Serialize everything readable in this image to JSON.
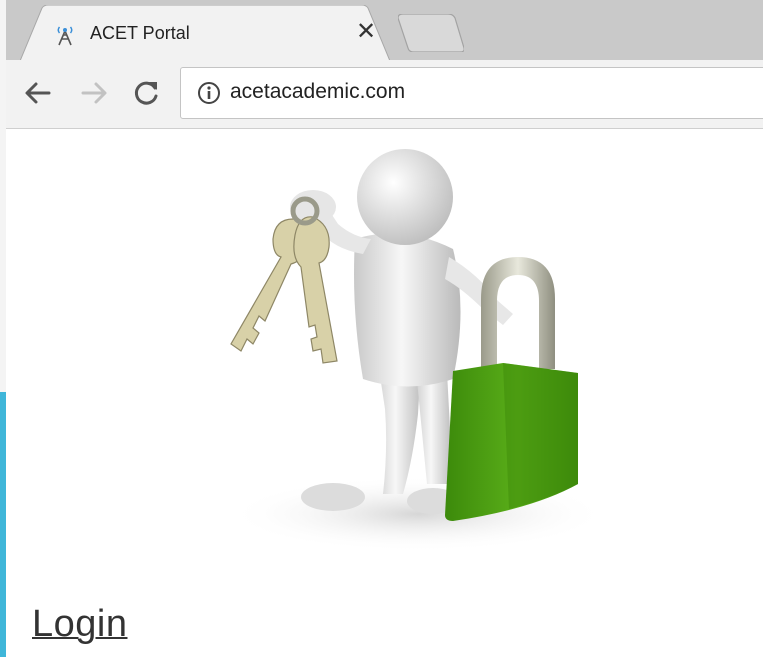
{
  "browser": {
    "tab": {
      "title": "ACET Portal",
      "close_glyph": "✕",
      "favicon": "radio-tower-icon"
    },
    "new_tab": {
      "icon": "new-tab-icon"
    },
    "toolbar": {
      "back_icon": "arrow-left-icon",
      "forward_icon": "arrow-right-icon",
      "reload_icon": "reload-icon",
      "site_info_icon": "info-icon",
      "url": "acetacademic.com"
    }
  },
  "page": {
    "hero_image": "figure-holding-keys-with-padlock",
    "login_link": "Login"
  },
  "colors": {
    "tabstrip": "#c9c9c9",
    "toolbar": "#f2f2f2",
    "padlock": "#4f9e13",
    "accent": "#3fb6d9"
  }
}
